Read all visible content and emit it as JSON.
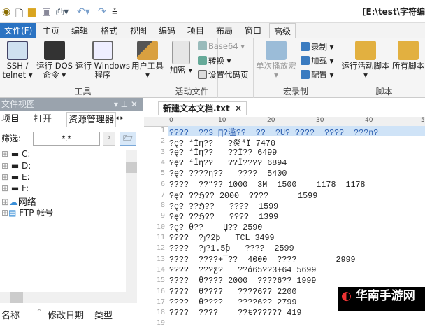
{
  "title": "[E:\\test\\字符编",
  "quick_access": [
    "app-logo",
    "new-file",
    "open-folder",
    "save",
    "print",
    "undo",
    "redo",
    "customize"
  ],
  "menu": [
    "文件(F)",
    "主页",
    "编辑",
    "格式",
    "视图",
    "编码",
    "项目",
    "布局",
    "窗口",
    "高级"
  ],
  "active_menu": "高级",
  "ribbon": {
    "tools": {
      "label": "工具",
      "buttons": [
        "SSH / telnet ▾",
        "运行 DOS 命令 ▾",
        "运行 Windows 程序",
        "用户工具 ▾"
      ]
    },
    "active_file": {
      "label": "活动文件",
      "encrypt": "加密",
      "base64": "Base64 ▾",
      "convert": "转换 ▾",
      "codepage": "设置代码页"
    },
    "macro": {
      "label": "宏录制",
      "play": "单次播放宏",
      "record": "录制 ▾",
      "load": "加载 ▾",
      "config": "配置 ▾"
    },
    "script": {
      "label": "脚本",
      "run": "运行活动脚本",
      "all": "所有脚本"
    }
  },
  "panel": {
    "title": "文件视图",
    "tabs": [
      "项目",
      "打开",
      "资源管理器"
    ],
    "filter_label": "筛选:",
    "filter_value": "*.*",
    "tree": [
      "C:",
      "D:",
      "E:",
      "F:",
      "网络",
      "FTP 帐号"
    ],
    "columns": [
      "名称",
      "修改日期",
      "类型"
    ]
  },
  "editor": {
    "tab": "新建文本文档.txt",
    "ruler": [
      "0",
      "10",
      "20",
      "30",
      "40",
      "5"
    ],
    "lines": [
      "????  ??3 ∏?滥??  ??  ?U? ????  ????  ???n?",
      "?ę? ⁴Ïη??   ?炎⁴Ï 7470",
      "?ę? ⁴Ïη??   ??Ï?? 6499",
      "?ę? ⁴Ïη??   ??Ï???? 6894",
      "?ę? ????η??   ????  5400",
      "????  ??”?? 1000  3M  1500    1178  1178",
      "?ę? ??ℌ?? 2000  ????      1599",
      "?ę? ??ℌ??   ????  1599",
      "?ę? ??ℌ??   ????  1399",
      "?ę? θ??    Џ?? 2590",
      "????  ?ȷ?2ƥ   TCL 3499",
      "????  ?ȷ?1.5ƥ   ????  2599",
      "????  ????+¯??  4000  ????        2999",
      "????  ???ƹ?   ??ά65??3+64 5699",
      "????  θ???? 2000  ????6?? 1999",
      "????  θ????   ????6?? 2200",
      "????  θ????   ????6?? 2799",
      "????  ????    ??ŧ?????? 419",
      ""
    ]
  },
  "watermark": "华南手游网"
}
